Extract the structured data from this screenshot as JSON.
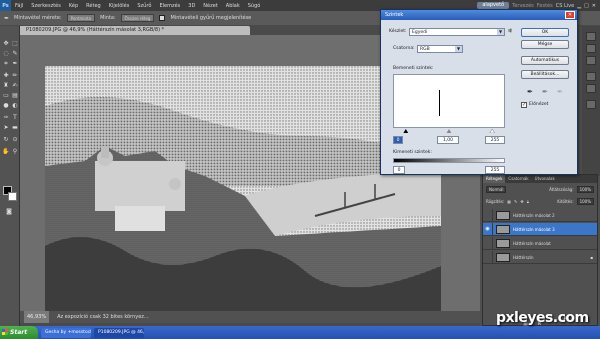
{
  "menubar": {
    "logo": "Ps",
    "items": [
      "Fájl",
      "Szerkesztés",
      "Kép",
      "Réteg",
      "Kijelölés",
      "Szűrő",
      "Elemzés",
      "3D",
      "Nézet",
      "Ablak",
      "Súgó"
    ],
    "workspace": "alapvető",
    "right_items": [
      "Tervezés",
      "Festés"
    ],
    "cslive": "CS Live"
  },
  "optbar": {
    "sample_size_label": "Mintavétel mérete:",
    "sample_size_value": "Pontminta",
    "sample_label": "Minta:",
    "sample_value": "Összes réteg",
    "ring_label": "Mintavételi gyűrű megjelenítése"
  },
  "document": {
    "tab_title": "P1080209.JPG @ 46,9% (Háttérszín másolat 3,RGB/8) *",
    "zoom": "46,93%",
    "status": "Az expozíció csak 32 bites környez..."
  },
  "dialog": {
    "title": "Szintek",
    "preset_label": "Készlet:",
    "preset_value": "Egyedi",
    "channel_label": "Csatorna:",
    "channel_value": "RGB",
    "input_label": "Bemeneti szintek:",
    "input_values": [
      "0",
      "1,00",
      "255"
    ],
    "output_label": "Kimeneti szintek:",
    "output_values": [
      "0",
      "255"
    ],
    "buttons": [
      "OK",
      "Mégse",
      "Automatikus",
      "Beállítások..."
    ],
    "preview_label": "Előnézet"
  },
  "layers": {
    "tabs": [
      "Rétegek",
      "Csatornák",
      "Útvonalak"
    ],
    "blend_mode": "Normál",
    "opacity_label": "Átlátszóság:",
    "opacity_value": "100%",
    "lock_label": "Rögzítés:",
    "fill_label": "Kitöltés:",
    "fill_value": "100%",
    "items": [
      {
        "name": "Háttérszín másolat 2",
        "active": false
      },
      {
        "name": "Háttérszín másolat 3",
        "active": true
      },
      {
        "name": "Háttérszín másolat",
        "active": false
      },
      {
        "name": "Háttérszín",
        "active": false
      }
    ]
  },
  "taskbar": {
    "start": "Start",
    "items": [
      "Gesha by +mosstock...",
      "P1080209.JPG @ 46,..."
    ]
  },
  "watermark": "pxleyes.com",
  "colors": {
    "accent": "#3a77c9",
    "titlebar": "#2a5db7",
    "taskbar": "#2352b0"
  }
}
